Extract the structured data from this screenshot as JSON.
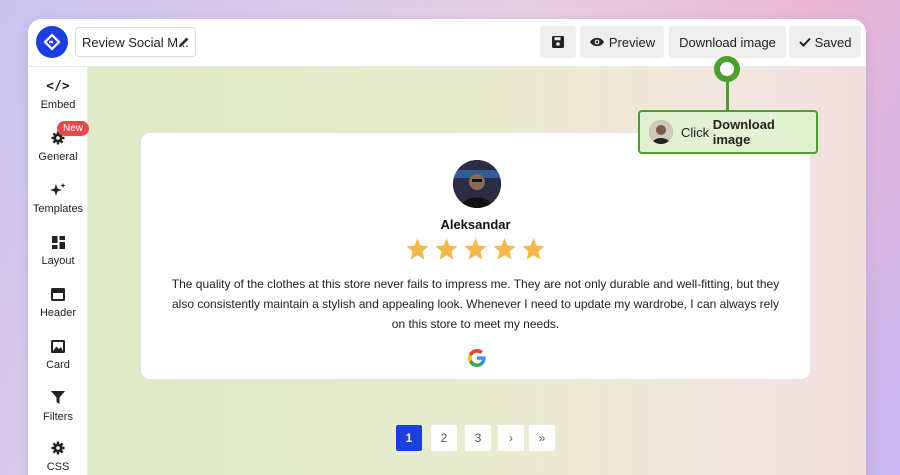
{
  "header": {
    "doc_title": "Review Social M...",
    "preview_label": "Preview",
    "download_label": "Download image",
    "saved_label": "Saved"
  },
  "sidebar": {
    "items": [
      {
        "label": "Embed",
        "icon": "code-icon"
      },
      {
        "label": "General",
        "icon": "gear-icon"
      },
      {
        "label": "Templates",
        "icon": "sparkle-icon"
      },
      {
        "label": "Layout",
        "icon": "layout-icon"
      },
      {
        "label": "Header",
        "icon": "header-icon"
      },
      {
        "label": "Card",
        "icon": "image-icon"
      },
      {
        "label": "Filters",
        "icon": "filter-icon"
      },
      {
        "label": "CSS",
        "icon": "gear-icon"
      }
    ],
    "new_badge": "New"
  },
  "review": {
    "author": "Aleksandar",
    "rating": 5,
    "text": "The quality of the clothes at this store never fails to impress me. They are not only durable and well-fitting, but they also consistently maintain a stylish and appealing look. Whenever I need to update my wardrobe, I can always rely on this store to meet my needs.",
    "source_icon": "google-icon"
  },
  "pagination": {
    "pages": [
      "1",
      "2",
      "3"
    ],
    "current": "1",
    "next": "›",
    "last": "»"
  },
  "callout": {
    "prefix": "Click ",
    "bold": "Download image"
  },
  "colors": {
    "brand": "#1d3fe0",
    "star": "#f2b84b",
    "callout_border": "#4aa02a",
    "badge": "#e5484d"
  }
}
